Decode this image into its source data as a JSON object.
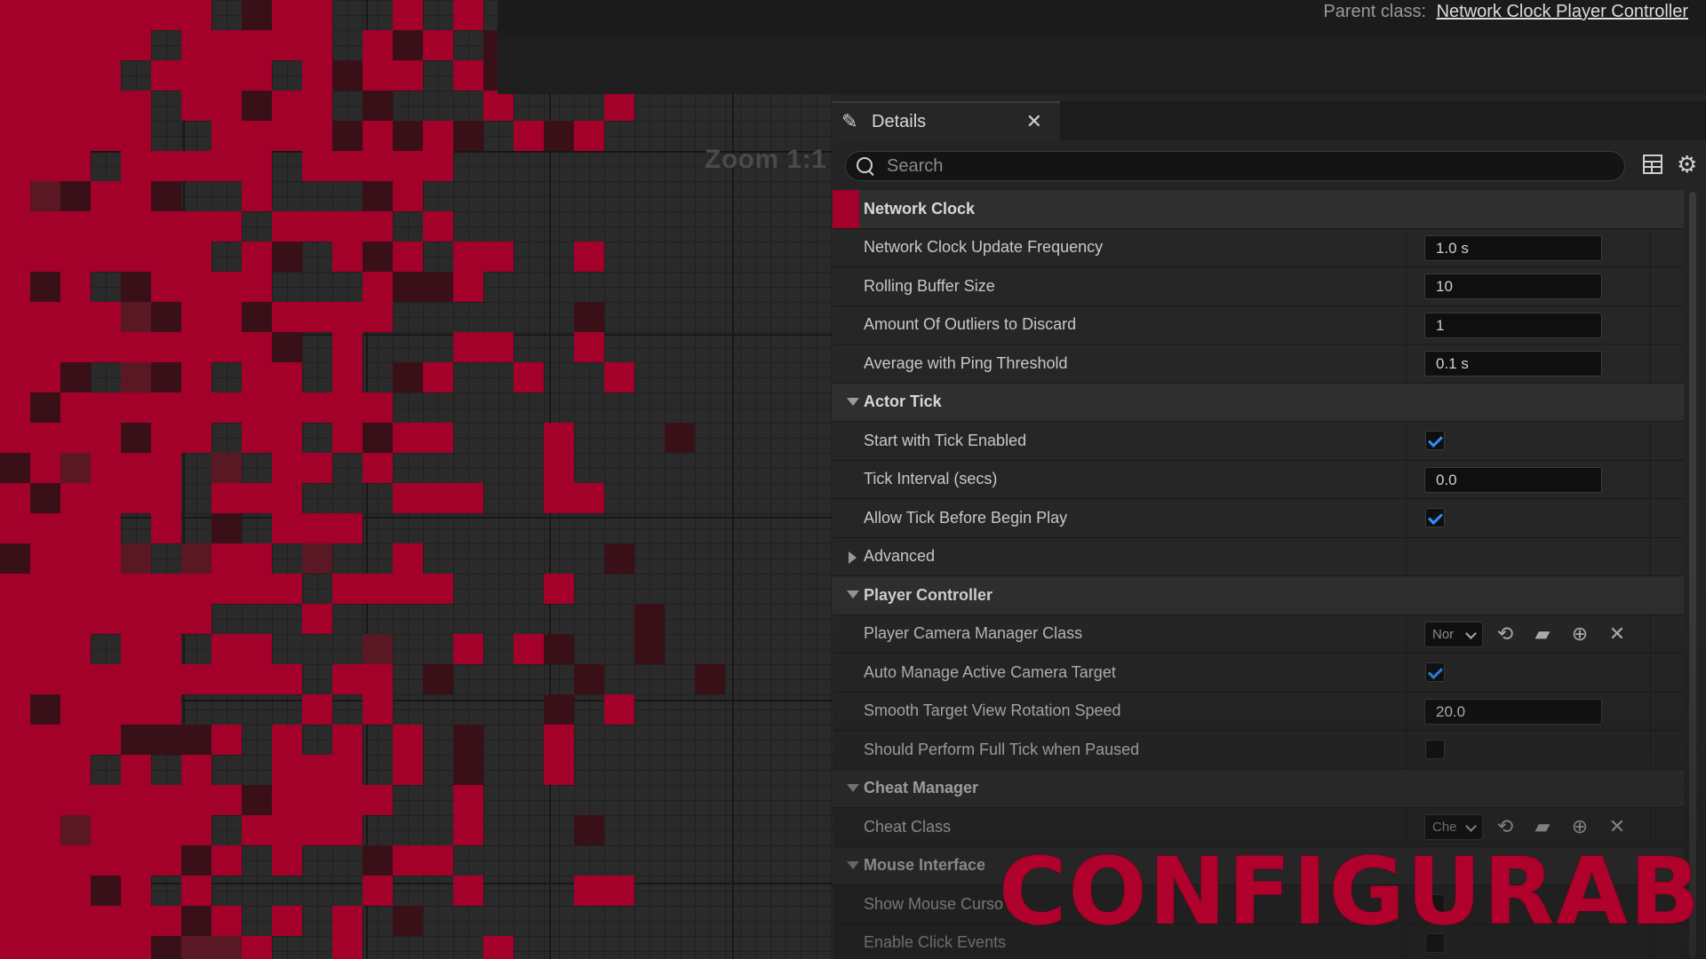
{
  "header": {
    "parent_class_label": "Parent class:",
    "parent_class_link": "Network Clock Player Controller"
  },
  "graph": {
    "zoom_label": "Zoom 1:1"
  },
  "details": {
    "tab_title": "Details",
    "search_placeholder": "Search",
    "rows": [
      {
        "type": "category",
        "label": "Network Clock",
        "marker": true
      },
      {
        "type": "value",
        "label": "Network Clock Update Frequency",
        "value": "1.0 s"
      },
      {
        "type": "value",
        "label": "Rolling Buffer Size",
        "value": "10"
      },
      {
        "type": "value",
        "label": "Amount Of Outliers to Discard",
        "value": "1"
      },
      {
        "type": "value",
        "label": "Average with Ping Threshold",
        "value": "0.1 s"
      },
      {
        "type": "category",
        "label": "Actor Tick",
        "expanded": true
      },
      {
        "type": "check",
        "label": "Start with Tick Enabled",
        "checked": true
      },
      {
        "type": "value",
        "label": "Tick Interval (secs)",
        "value": "0.0"
      },
      {
        "type": "check",
        "label": "Allow Tick Before Begin Play",
        "checked": true
      },
      {
        "type": "subgroup",
        "label": "Advanced",
        "expanded": false
      },
      {
        "type": "category",
        "label": "Player Controller",
        "expanded": true
      },
      {
        "type": "class",
        "label": "Player Camera Manager Class",
        "value": "Nor"
      },
      {
        "type": "check",
        "label": "Auto Manage Active Camera Target",
        "checked": true
      },
      {
        "type": "value",
        "label": "Smooth Target View Rotation Speed",
        "value": "20.0"
      },
      {
        "type": "check",
        "label": "Should Perform Full Tick when Paused",
        "checked": false
      },
      {
        "type": "category",
        "label": "Cheat Manager",
        "expanded": true
      },
      {
        "type": "class",
        "label": "Cheat Class",
        "value": "Che"
      },
      {
        "type": "category",
        "label": "Mouse Interface",
        "expanded": true
      },
      {
        "type": "check",
        "label": "Show Mouse Curso",
        "checked": false
      },
      {
        "type": "check",
        "label": "Enable Click Events",
        "checked": false
      }
    ]
  },
  "overlay": {
    "brand_text": "CONFIGURABLE",
    "brand_color": "#b0002c"
  },
  "colors": {
    "accent_red": "#a3002a",
    "check_blue": "#2f8fff"
  }
}
